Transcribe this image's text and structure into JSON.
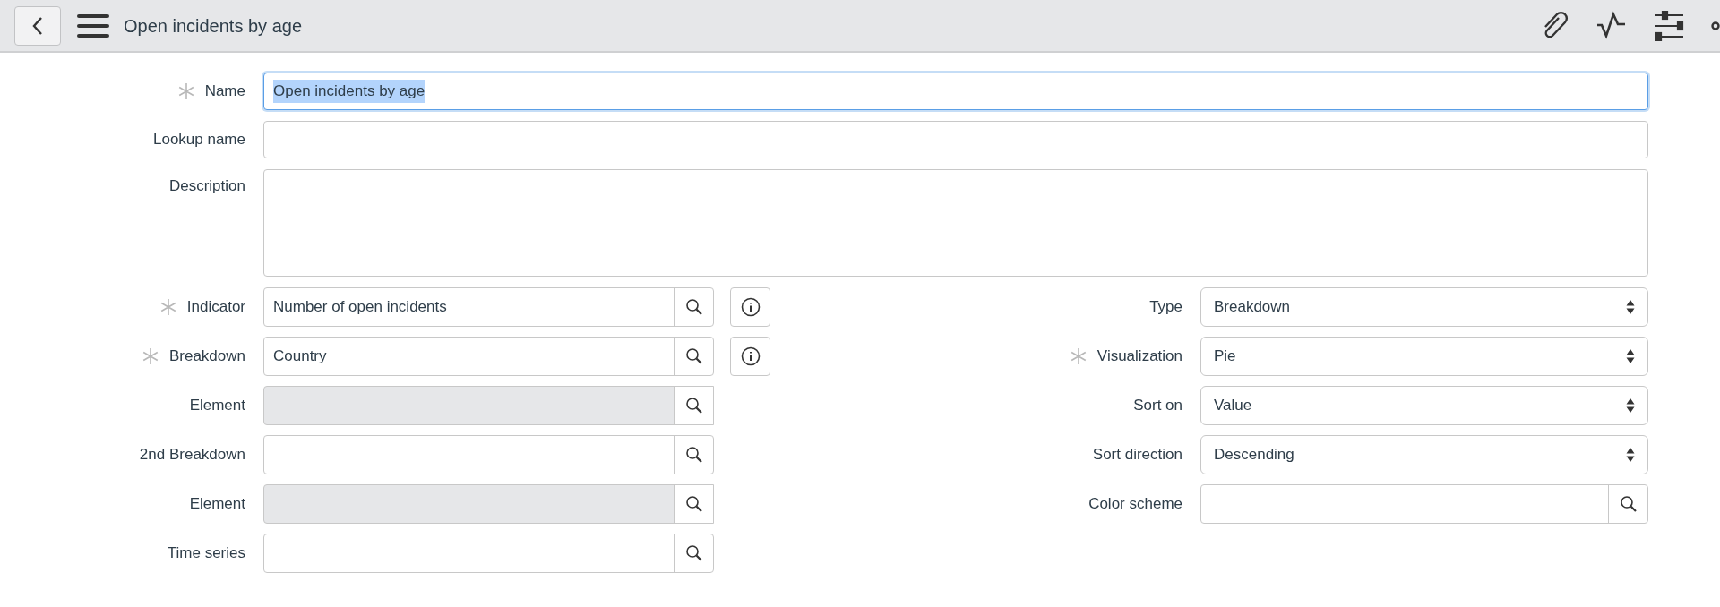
{
  "header": {
    "title": "Open incidents by age"
  },
  "top_fields": [
    {
      "label": "Name",
      "required": true,
      "value": "Open incidents by age",
      "focused": true,
      "text_selected": true,
      "kind": "text"
    },
    {
      "label": "Lookup name",
      "required": false,
      "focused": false,
      "kind": "text"
    },
    {
      "label": "Description",
      "required": false,
      "focused": false,
      "kind": "textarea"
    }
  ],
  "left_fields": [
    {
      "label": "Indicator",
      "required": true,
      "value": "Number of open incidents",
      "kind": "reference",
      "info_button": true
    },
    {
      "label": "Breakdown",
      "required": true,
      "value": "Country",
      "kind": "reference",
      "info_button": true
    },
    {
      "label": "Element",
      "required": false,
      "kind": "readonly",
      "info_button": false
    },
    {
      "label": "2nd Breakdown",
      "required": false,
      "kind": "reference",
      "info_button": false
    },
    {
      "label": "Element",
      "required": false,
      "kind": "readonly",
      "info_button": false
    },
    {
      "label": "Time series",
      "required": false,
      "kind": "reference",
      "info_button": false
    }
  ],
  "right_fields": [
    {
      "label": "Type",
      "required": false,
      "value": "Breakdown",
      "kind": "select"
    },
    {
      "label": "Visualization",
      "required": true,
      "value": "Pie",
      "kind": "select"
    },
    {
      "label": "Sort on",
      "required": false,
      "value": "Value",
      "kind": "select"
    },
    {
      "label": "Sort direction",
      "required": false,
      "value": "Descending",
      "kind": "select"
    },
    {
      "label": "Color scheme",
      "required": false,
      "kind": "reference"
    }
  ]
}
